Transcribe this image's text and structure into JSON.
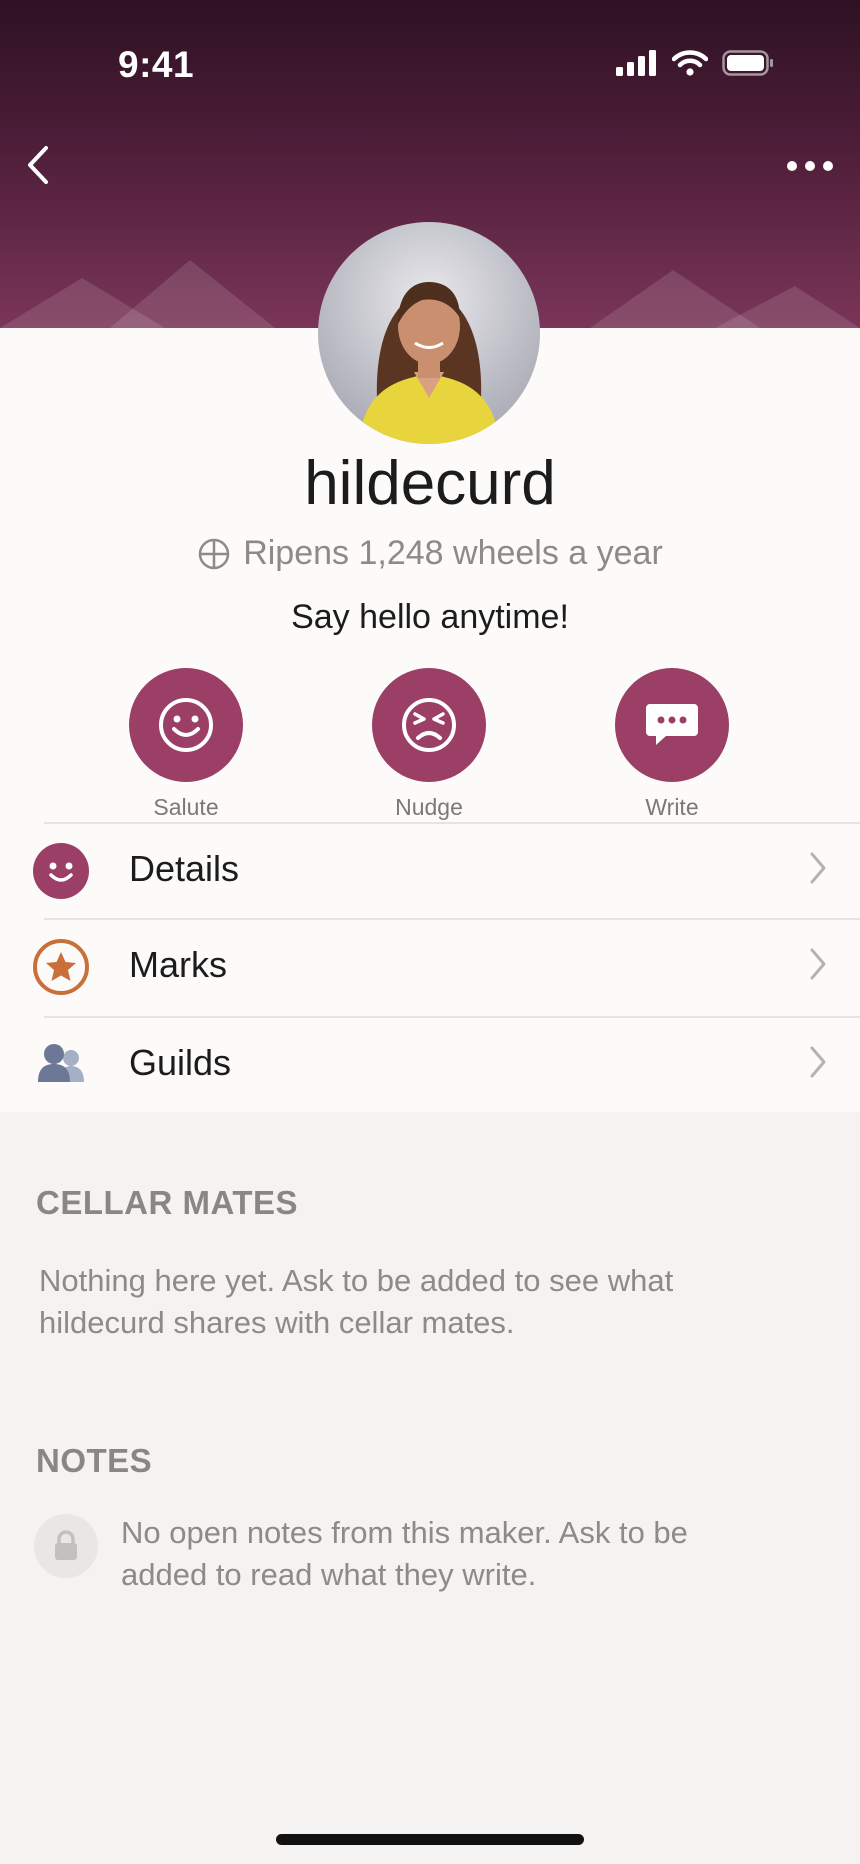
{
  "status_bar": {
    "time": "9:41"
  },
  "profile": {
    "username": "hildecurd",
    "ripens_text": "Ripens 1,248 wheels a year",
    "greeting": "Say hello anytime!"
  },
  "actions": [
    {
      "label": "Salute",
      "icon": "smile-icon"
    },
    {
      "label": "Nudge",
      "icon": "grimace-icon"
    },
    {
      "label": "Write",
      "icon": "message-icon"
    }
  ],
  "menu": [
    {
      "label": "Details",
      "icon": "smile-icon"
    },
    {
      "label": "Marks",
      "icon": "star-icon"
    },
    {
      "label": "Guilds",
      "icon": "people-icon"
    }
  ],
  "cellar_mates": {
    "title": "CELLAR MATES",
    "line1": "Nothing here yet. Ask to be added to see what",
    "line2": "hildecurd shares with cellar mates."
  },
  "notes": {
    "title": "NOTES",
    "line1": "No open notes from this maker. Ask to be",
    "line2": "added to read what they write."
  },
  "colors": {
    "accent": "#9b3f66",
    "header_top": "#2e1223",
    "header_bottom": "#7a3558",
    "star_accent": "#c9703a",
    "people_icon": "#7a86a0"
  }
}
